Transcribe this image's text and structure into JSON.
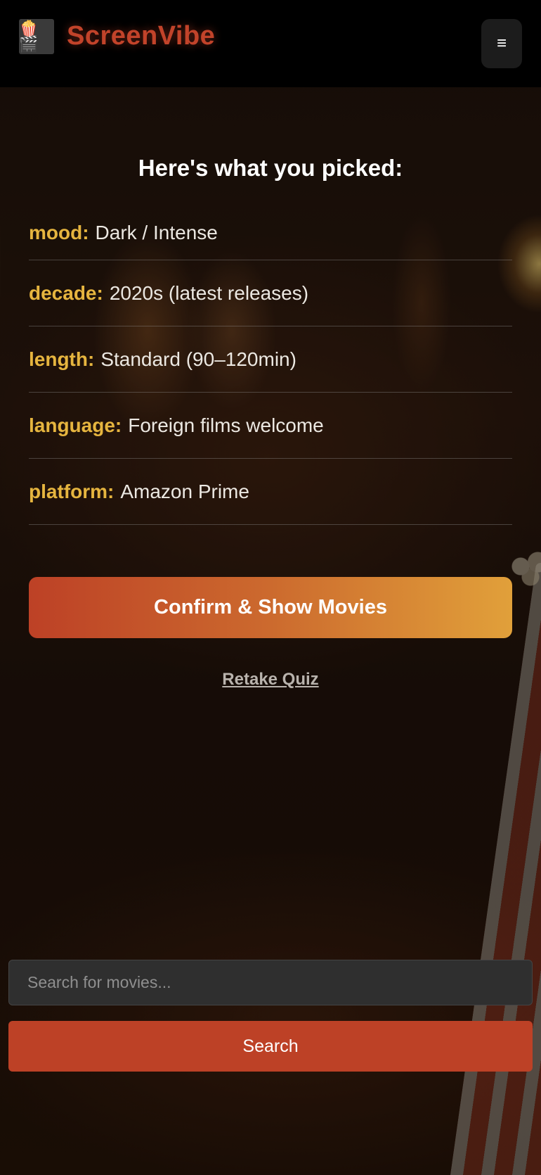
{
  "header": {
    "logo_icon": "popcorn-clapper-icon",
    "logo_glyph": "🍿🎬",
    "brand_name": "ScreenVibe",
    "menu_icon": "hamburger-menu-icon",
    "menu_glyph": "≡"
  },
  "summary": {
    "heading": "Here's what you picked:",
    "picks": [
      {
        "key": "mood:",
        "value": "Dark / Intense"
      },
      {
        "key": "decade:",
        "value": "2020s (latest releases)"
      },
      {
        "key": "length:",
        "value": "Standard (90–120min)"
      },
      {
        "key": "language:",
        "value": "Foreign films welcome"
      },
      {
        "key": "platform:",
        "value": "Amazon Prime"
      }
    ],
    "confirm_label": "Confirm & Show Movies",
    "retake_label": "Retake Quiz"
  },
  "search": {
    "placeholder": "Search for movies...",
    "value": "",
    "button_label": "Search"
  },
  "colors": {
    "brand": "#c2432a",
    "accent_key": "#e6b53f",
    "button_start": "#bd4126",
    "button_end": "#e1a03a"
  }
}
